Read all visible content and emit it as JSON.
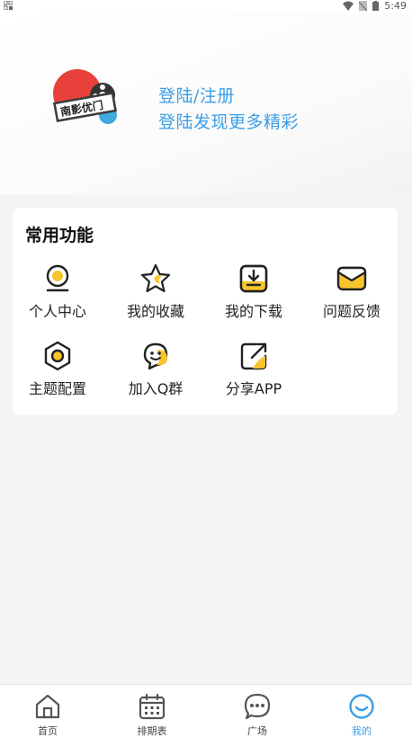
{
  "status_bar": {
    "time": "5:49"
  },
  "profile": {
    "logo_text": "南影优门",
    "login_label": "登陆/注册",
    "login_subtitle": "登陆发现更多精彩"
  },
  "functions": {
    "title": "常用功能",
    "items": [
      {
        "label": "个人中心",
        "icon": "user-center-icon"
      },
      {
        "label": "我的收藏",
        "icon": "star-icon"
      },
      {
        "label": "我的下载",
        "icon": "download-icon"
      },
      {
        "label": "问题反馈",
        "icon": "mail-icon"
      },
      {
        "label": "主题配置",
        "icon": "theme-icon"
      },
      {
        "label": "加入Q群",
        "icon": "qq-icon"
      },
      {
        "label": "分享APP",
        "icon": "share-icon"
      }
    ]
  },
  "tabbar": {
    "tabs": [
      {
        "label": "首页",
        "icon": "home-icon"
      },
      {
        "label": "排期表",
        "icon": "calendar-icon"
      },
      {
        "label": "广场",
        "icon": "chat-bubble-icon"
      },
      {
        "label": "我的",
        "icon": "smile-icon"
      }
    ],
    "active_index": 3
  },
  "colors": {
    "accent": "#3a9ee8",
    "icon_yellow": "#f7c52b",
    "icon_stroke": "#222222",
    "logo_red": "#e8413c",
    "logo_blue": "#3fa9e0"
  }
}
